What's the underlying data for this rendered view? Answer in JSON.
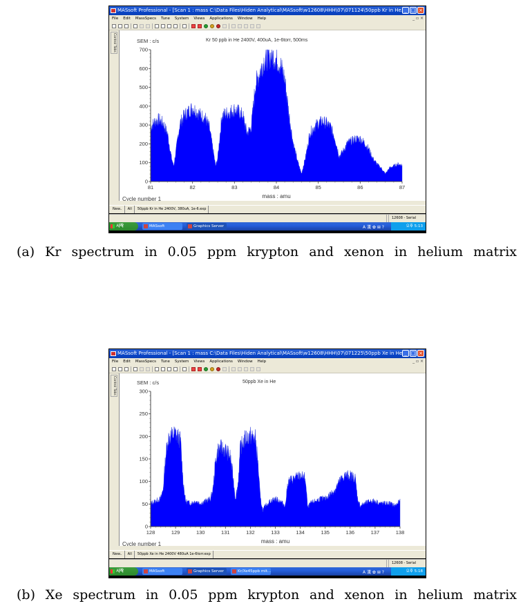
{
  "figure": {
    "caption_a": "(a) Kr spectrum in 0.05 ppm krypton and xenon in helium matrix",
    "caption_b": "(b) Xe spectrum in 0.05 ppm krypton and xenon in helium matrix"
  },
  "screens": [
    {
      "window_title": "MASsoft Professional - [Scan 1 : mass C:\\Data Files\\Hiden Analytical\\MASsoft\\w12608\\HHH\\07\\071124\\50ppb Kr in He...",
      "menu": [
        "File",
        "Edit",
        "MassSpecs",
        "Tune",
        "System",
        "Views",
        "Applications",
        "Window",
        "Help"
      ],
      "side_tab": "Control Tabs",
      "doc_tabs": [
        "New..",
        "All",
        "50ppb Kr in He 2400V, 380uA, 1e-6.exp"
      ],
      "status_right": "12608 - Serial",
      "taskbar": {
        "start_label": "시작",
        "tasks": [
          "MASsoft",
          "Graphics Server"
        ],
        "ime": "A 漢 ✿ ⊞ ?",
        "clock": "오후 5:13"
      }
    },
    {
      "window_title": "MASsoft Professional - [Scan 1 : mass C:\\Data Files\\Hiden Analytical\\MASsoft\\w12608\\HHH\\07\\071225\\50ppb Xe in He...",
      "menu": [
        "File",
        "Edit",
        "MassSpecs",
        "Tune",
        "System",
        "Views",
        "Applications",
        "Window",
        "Help"
      ],
      "side_tab": "Control Tabs",
      "doc_tabs": [
        "New..",
        "All",
        "50ppb Xe in He 2400V 480uA 1e-6torr.exp"
      ],
      "status_right": "12608 - Serial",
      "taskbar": {
        "start_label": "시작",
        "tasks": [
          "MASsoft",
          "Graphics Server",
          "Kr/Xe45ppb mit..."
        ],
        "ime": "A 漢 ✿ ⊞ ?",
        "clock": "오후 5:18"
      }
    }
  ],
  "chart_data": [
    {
      "type": "area",
      "title": "Kr 50 ppb in He 2400V, 400uA, 1e-6torr, 500ms",
      "ylabel": "SEM : c/s",
      "xlabel": "mass : amu",
      "footer": "Cycle number 1",
      "xlim": [
        81,
        87
      ],
      "ylim": [
        0,
        700
      ],
      "xticks": [
        "81",
        "82",
        "83",
        "84",
        "85",
        "86",
        "87"
      ],
      "yticks": [
        "0",
        "100",
        "200",
        "300",
        "400",
        "500",
        "600",
        "700"
      ],
      "color": "#0000ff",
      "x": [
        81.0,
        81.1,
        81.2,
        81.3,
        81.4,
        81.5,
        81.55,
        81.6,
        81.7,
        81.8,
        81.9,
        82.0,
        82.1,
        82.2,
        82.3,
        82.4,
        82.5,
        82.55,
        82.6,
        82.7,
        82.8,
        82.9,
        83.0,
        83.1,
        83.2,
        83.3,
        83.4,
        83.5,
        83.6,
        83.7,
        83.8,
        83.9,
        84.0,
        84.1,
        84.2,
        84.3,
        84.4,
        84.5,
        84.6,
        84.7,
        84.8,
        84.9,
        85.0,
        85.1,
        85.2,
        85.3,
        85.4,
        85.5,
        85.6,
        85.7,
        85.8,
        85.9,
        86.0,
        86.1,
        86.2,
        86.3,
        86.4,
        86.5,
        86.6,
        86.7,
        86.8,
        86.9,
        87.0
      ],
      "values": [
        280,
        310,
        320,
        300,
        250,
        120,
        80,
        150,
        300,
        340,
        360,
        380,
        360,
        340,
        330,
        280,
        150,
        80,
        120,
        340,
        350,
        360,
        370,
        360,
        340,
        250,
        280,
        500,
        560,
        620,
        640,
        650,
        630,
        600,
        530,
        350,
        200,
        110,
        40,
        130,
        250,
        280,
        300,
        310,
        300,
        280,
        220,
        130,
        160,
        200,
        210,
        220,
        220,
        200,
        170,
        120,
        90,
        70,
        40,
        70,
        80,
        90,
        85
      ]
    },
    {
      "type": "area",
      "title": "50ppb Xe in He",
      "ylabel": "SEM : c/s",
      "xlabel": "mass : amu",
      "footer": "Cycle number 1",
      "xlim": [
        128,
        138
      ],
      "ylim": [
        0,
        300
      ],
      "xticks": [
        "128",
        "129",
        "130",
        "131",
        "132",
        "133",
        "134",
        "135",
        "136",
        "137",
        "138"
      ],
      "yticks": [
        "0",
        "50",
        "100",
        "150",
        "200",
        "250",
        "300"
      ],
      "color": "#0000ff",
      "x": [
        128.0,
        128.2,
        128.4,
        128.5,
        128.6,
        128.7,
        128.8,
        129.0,
        129.2,
        129.3,
        129.4,
        129.6,
        129.8,
        130.0,
        130.2,
        130.4,
        130.5,
        130.6,
        130.7,
        130.8,
        131.0,
        131.2,
        131.3,
        131.4,
        131.5,
        131.6,
        131.8,
        132.0,
        132.2,
        132.3,
        132.4,
        132.5,
        132.6,
        132.8,
        133.0,
        133.2,
        133.4,
        133.5,
        133.6,
        133.8,
        134.0,
        134.2,
        134.3,
        134.4,
        134.6,
        134.8,
        135.0,
        135.2,
        135.4,
        135.6,
        135.8,
        136.0,
        136.2,
        136.3,
        136.4,
        136.6,
        136.8,
        137.0,
        137.2,
        137.4,
        137.6,
        137.8,
        138.0
      ],
      "values": [
        50,
        55,
        60,
        80,
        150,
        190,
        195,
        200,
        185,
        100,
        55,
        50,
        55,
        50,
        55,
        60,
        80,
        140,
        165,
        170,
        165,
        150,
        110,
        60,
        90,
        170,
        190,
        195,
        190,
        140,
        60,
        35,
        45,
        55,
        60,
        55,
        45,
        95,
        100,
        105,
        110,
        105,
        40,
        50,
        55,
        60,
        60,
        70,
        80,
        100,
        110,
        110,
        105,
        60,
        45,
        50,
        55,
        55,
        50,
        50,
        50,
        45,
        55
      ]
    }
  ]
}
